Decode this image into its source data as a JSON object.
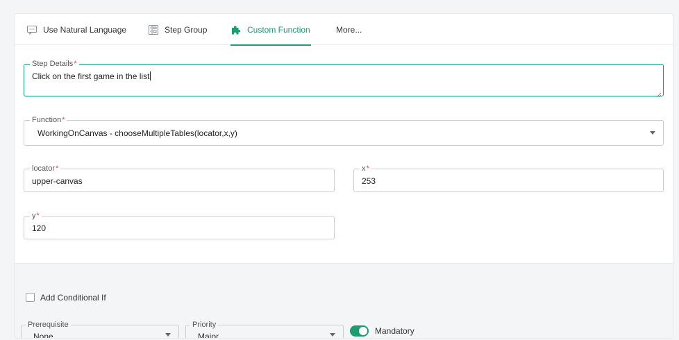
{
  "tabs": [
    {
      "label": "Use Natural Language",
      "icon": "chat-icon"
    },
    {
      "label": "Step Group",
      "icon": "step-group-icon"
    },
    {
      "label": "Custom Function",
      "icon": "puzzle-icon",
      "active": true
    },
    {
      "label": "More...",
      "icon": ""
    }
  ],
  "step_details": {
    "label": "Step Details",
    "required": "*",
    "value": "Click on the first game in the list"
  },
  "function": {
    "label": "Function",
    "required": "*",
    "value": "WorkingOnCanvas - chooseMultipleTables(locator,x,y)"
  },
  "locator": {
    "label": "locator",
    "required": "*",
    "value": "upper-canvas"
  },
  "x": {
    "label": "x",
    "required": "*",
    "value": "253"
  },
  "y": {
    "label": "y",
    "required": "*",
    "value": "120"
  },
  "conditional": {
    "label": "Add Conditional If",
    "checked": false
  },
  "prerequisite": {
    "label": "Prerequisite",
    "value": "None"
  },
  "priority": {
    "label": "Priority",
    "value": "Major"
  },
  "mandatory": {
    "label": "Mandatory",
    "on": true
  },
  "colors": {
    "accent": "#1e9b6f",
    "required": "#e0454a",
    "footer_bg": "#f3f5f7"
  }
}
